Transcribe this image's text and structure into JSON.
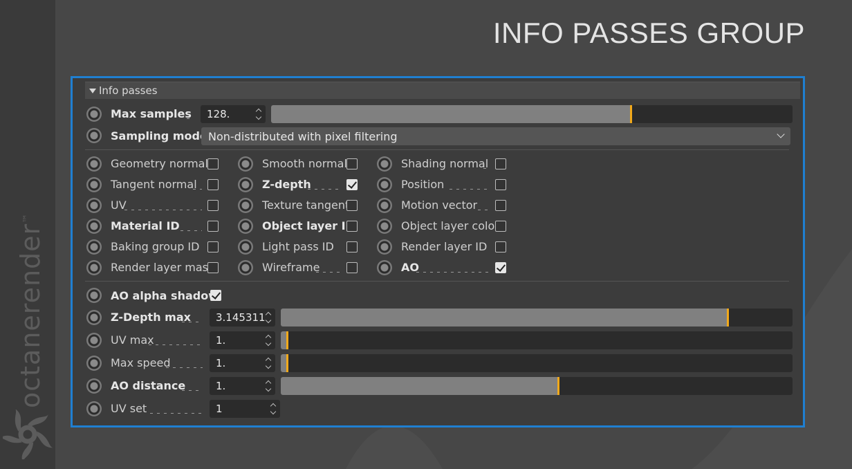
{
  "brand": {
    "name": "octanerender",
    "trademark": "™"
  },
  "page_title": "INFO PASSES GROUP",
  "panel": {
    "title": "Info passes",
    "max_samples": {
      "label": "Max samples",
      "value": "128.",
      "level": 0.69
    },
    "sampling_mode": {
      "label": "Sampling mode",
      "value": "Non-distributed with pixel filtering"
    },
    "passes": {
      "col1": [
        {
          "label": "Geometry normal",
          "checked": false,
          "bold": false
        },
        {
          "label": "Tangent normal",
          "checked": false,
          "bold": false
        },
        {
          "label": "UV",
          "checked": false,
          "bold": false
        },
        {
          "label": "Material ID",
          "checked": false,
          "bold": true
        },
        {
          "label": "Baking group ID",
          "checked": false,
          "bold": false
        },
        {
          "label": "Render layer mask",
          "checked": false,
          "bold": false
        }
      ],
      "col2": [
        {
          "label": "Smooth normal",
          "checked": false,
          "bold": false
        },
        {
          "label": "Z-depth",
          "checked": true,
          "bold": true
        },
        {
          "label": "Texture tangent",
          "checked": false,
          "bold": false
        },
        {
          "label": "Object layer ID",
          "checked": false,
          "bold": true
        },
        {
          "label": "Light pass ID",
          "checked": false,
          "bold": false
        },
        {
          "label": "Wireframe",
          "checked": false,
          "bold": false
        }
      ],
      "col3": [
        {
          "label": "Shading normal",
          "checked": false,
          "bold": false
        },
        {
          "label": "Position",
          "checked": false,
          "bold": false
        },
        {
          "label": "Motion vector",
          "checked": false,
          "bold": false
        },
        {
          "label": "Object layer color",
          "checked": false,
          "bold": false
        },
        {
          "label": "Render layer ID",
          "checked": false,
          "bold": false
        },
        {
          "label": "AO",
          "checked": true,
          "bold": true
        }
      ]
    },
    "ao_alpha_shadow": {
      "label": "AO alpha shadow",
      "checked": true
    },
    "params": [
      {
        "label": "Z-Depth max",
        "value": "3.145311",
        "bold": true,
        "level": 0.873
      },
      {
        "label": "UV max",
        "value": "1.",
        "bold": false,
        "level": 0.012
      },
      {
        "label": "Max speed",
        "value": "1.",
        "bold": false,
        "level": 0.012
      },
      {
        "label": "AO distance",
        "value": "1.",
        "bold": true,
        "level": 0.542
      }
    ],
    "uv_set": {
      "label": "UV set",
      "value": "1"
    }
  },
  "colors": {
    "frame": "#1f7fd1",
    "handle": "#f2a91a"
  }
}
